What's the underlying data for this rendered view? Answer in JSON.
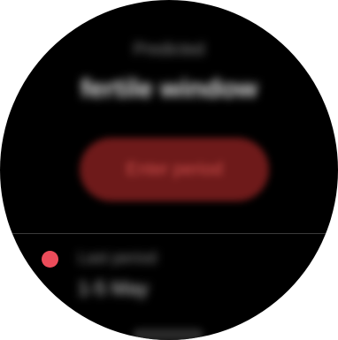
{
  "header": {
    "label": "Predicted",
    "title": "fertile window"
  },
  "action": {
    "label": "Enter period"
  },
  "entry": {
    "caption": "Last period",
    "value": "1-5 May",
    "dot_color": "#ec4c5a"
  },
  "colors": {
    "accent": "#ec4c5a",
    "button_bg": "#6e1a1a",
    "background": "#000000"
  }
}
